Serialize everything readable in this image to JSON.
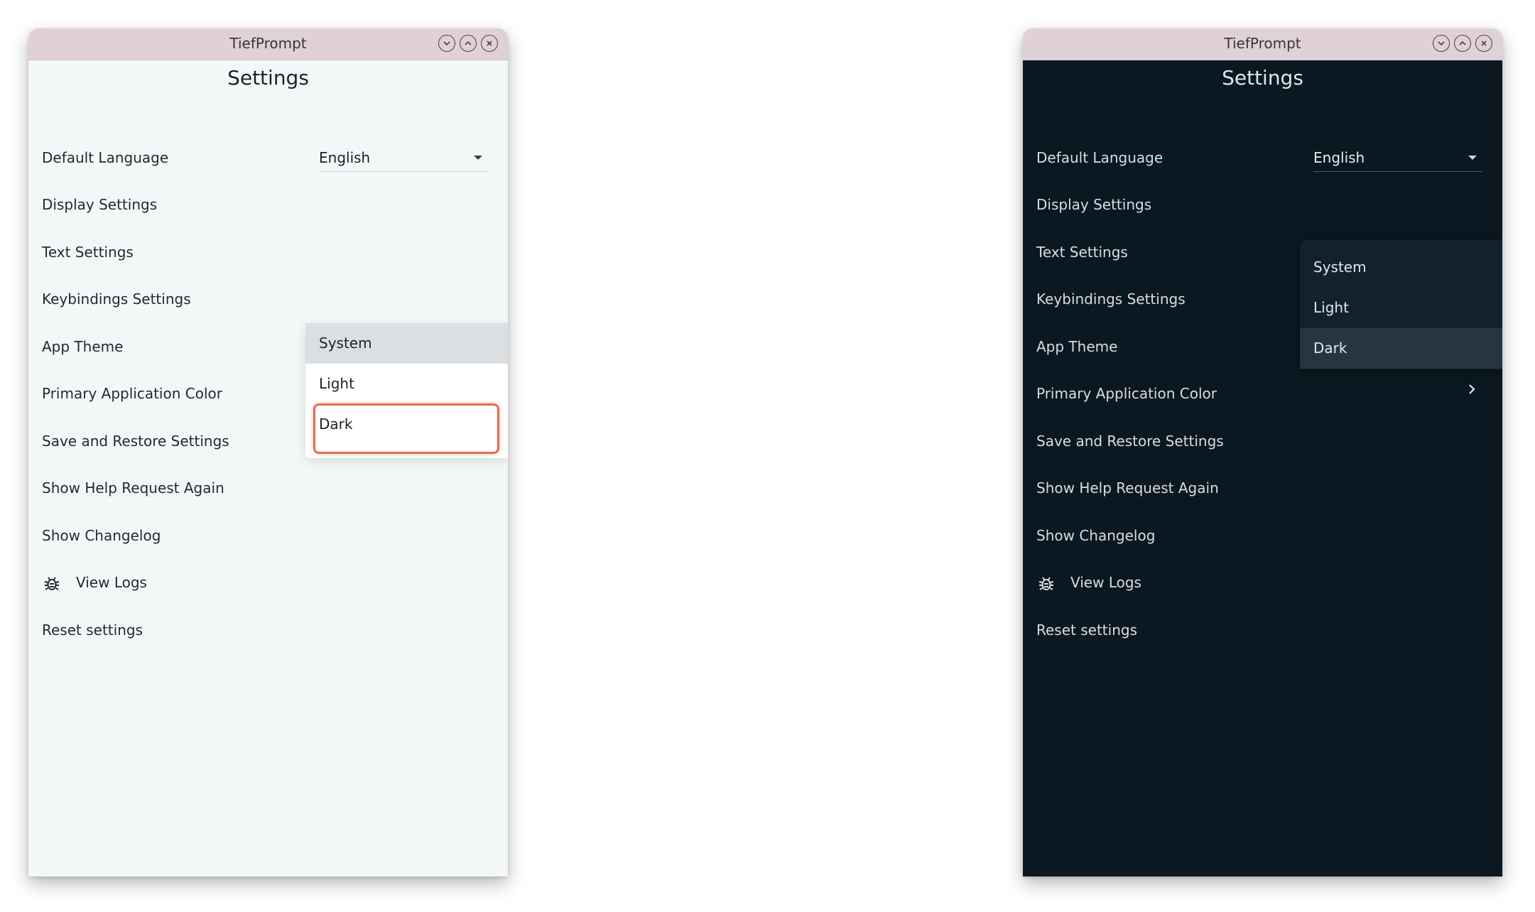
{
  "windows": {
    "light": {
      "title": "TiefPrompt",
      "heading": "Settings",
      "items": {
        "default_language": "Default Language",
        "display_settings": "Display Settings",
        "text_settings": "Text Settings",
        "keybindings_settings": "Keybindings Settings",
        "app_theme": "App Theme",
        "primary_color": "Primary Application Color",
        "save_restore": "Save and Restore Settings",
        "show_help": "Show Help Request Again",
        "show_changelog": "Show Changelog",
        "view_logs": "View Logs",
        "reset_settings": "Reset settings"
      },
      "language_select": {
        "value": "English"
      },
      "theme_menu": {
        "options": [
          "System",
          "Light",
          "Dark"
        ],
        "selected": "System",
        "highlighted": "Dark"
      }
    },
    "dark": {
      "title": "TiefPrompt",
      "heading": "Settings",
      "items": {
        "default_language": "Default Language",
        "display_settings": "Display Settings",
        "text_settings": "Text Settings",
        "keybindings_settings": "Keybindings Settings",
        "app_theme": "App Theme",
        "primary_color": "Primary Application Color",
        "save_restore": "Save and Restore Settings",
        "show_help": "Show Help Request Again",
        "show_changelog": "Show Changelog",
        "view_logs": "View Logs",
        "reset_settings": "Reset settings"
      },
      "language_select": {
        "value": "English"
      },
      "theme_menu": {
        "options": [
          "System",
          "Light",
          "Dark"
        ],
        "selected": "Dark"
      }
    }
  },
  "icons": {
    "minimize": "chevron-down-icon",
    "maximize": "chevron-up-icon",
    "close": "close-icon",
    "view_logs": "bug-icon",
    "submenu": "chevron-right-icon"
  },
  "colors": {
    "titlebar": "#e0d0d7",
    "light_background": "#f3f7f7",
    "dark_background": "#0b1821",
    "highlight": "#e36c55"
  }
}
